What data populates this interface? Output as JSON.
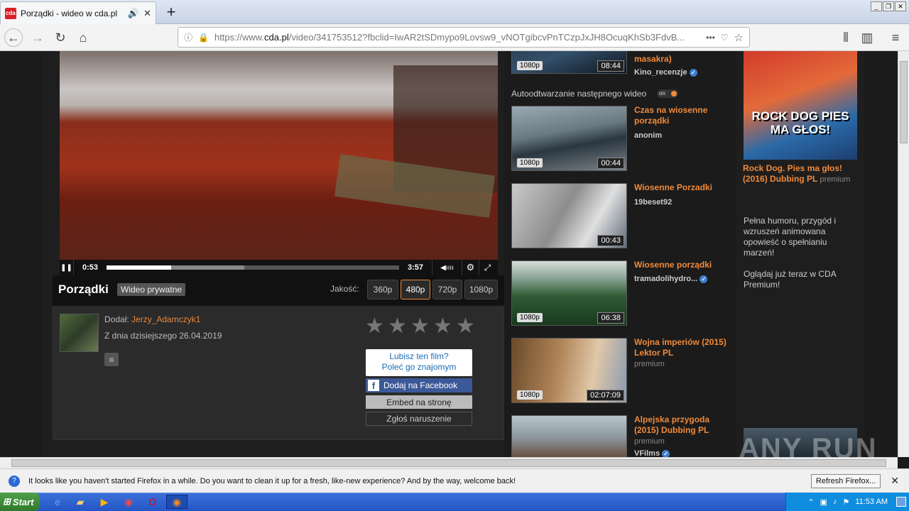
{
  "browser": {
    "tab_title": "Porządki - wideo w cda.pl",
    "favicon_text": "cda",
    "url_prefix": "https://www.",
    "url_domain": "cda.pl",
    "url_rest": "/video/341753512?fbclid=IwAR2tSDmypo9Lovsw9_vNOTgibcvPnTCzpJxJH8OcuqKhSb3FdvB..."
  },
  "player": {
    "current_time": "0:53",
    "duration": "3:57",
    "progress": 0.22,
    "buffered": 0.47
  },
  "video": {
    "title": "Porządki",
    "private_label": "Wideo prywatne",
    "quality_label": "Jakość:",
    "qualities": [
      "360p",
      "480p",
      "720p",
      "1080p"
    ],
    "selected_quality": "480p"
  },
  "uploader": {
    "added_label": "Dodał:",
    "name": "Jerzy_Adamczyk1",
    "date_text": "Z dnia dzisiejszego 26.04.2019"
  },
  "share": {
    "recommend_line1": "Lubisz ten film?",
    "recommend_line2": "Poleć go znajomym",
    "facebook_label": "Dodaj na Facebook",
    "embed_label": "Embed na stronę",
    "report_label": "Zgłoś naruszenie"
  },
  "sidebar": {
    "top_item": {
      "title": "masakra)",
      "author": "Kino_recenzje",
      "quality": "1080p",
      "duration": "08:44"
    },
    "autoplay_label": "Autoodtwarzanie następnego wideo",
    "autoplay_state": "on",
    "items": [
      {
        "title": "Czas na wiosenne porządki",
        "author": "anonim",
        "quality": "1080p",
        "duration": "00:44",
        "premium": ""
      },
      {
        "title": "Wiosenne Porzadki",
        "author": "19beset92",
        "quality": "",
        "duration": "00:43",
        "premium": ""
      },
      {
        "title": "Wiosenne porządki",
        "author": "tramadolihydro...",
        "quality": "1080p",
        "duration": "06:38",
        "premium": ""
      },
      {
        "title": "Wojna imperiów (2015) Lektor PL",
        "author": "",
        "quality": "1080p",
        "duration": "02:07:09",
        "premium": "premium"
      },
      {
        "title": "Alpejska przygoda (2015) Dubbing PL",
        "author": "VFilms",
        "quality": "",
        "duration": "",
        "premium": "premium"
      }
    ]
  },
  "promo": {
    "ad_title": "ROCK DOG PIES MA GŁOS!",
    "title": "Rock Dog. Pies ma głos! (2016) Dubbing PL",
    "premium": "premium",
    "description": "Pełna humoru, przygód i wzruszeń animowana opowieść o spełnianiu marzeń!",
    "cta": "Oglądaj już teraz w CDA Premium!"
  },
  "notification": {
    "text": "It looks like you haven't started Firefox in a while. Do you want to clean it up for a fresh, like-new experience? And by the way, welcome back!",
    "button": "Refresh Firefox..."
  },
  "taskbar": {
    "start": "Start",
    "clock": "11:53 AM"
  },
  "watermark": "ANY RUN",
  "colors": {
    "accent": "#f08a3a",
    "facebook": "#3b5998",
    "link": "#e8883a"
  }
}
